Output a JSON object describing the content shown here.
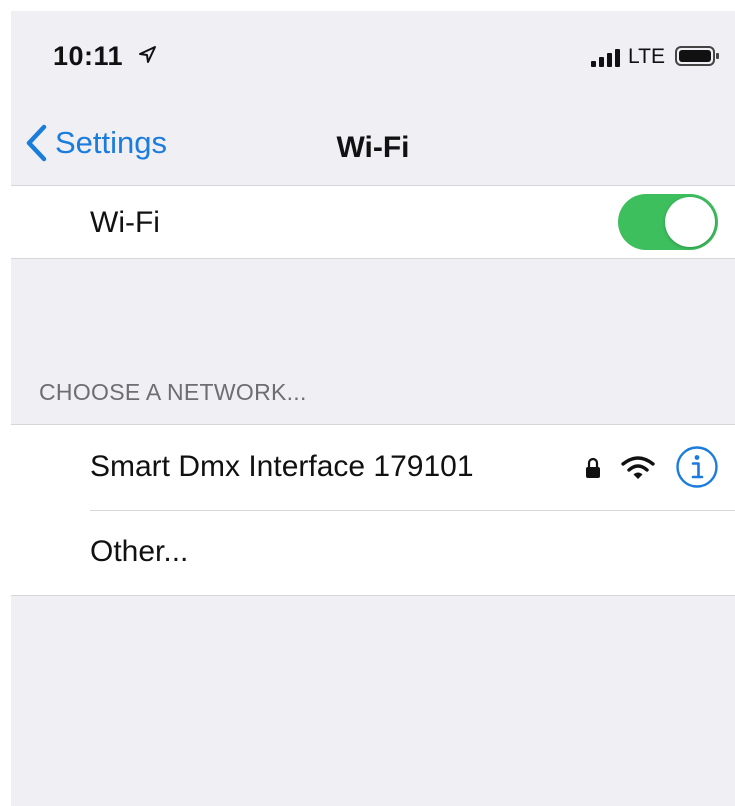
{
  "status_bar": {
    "time": "10:11",
    "network_type": "LTE",
    "icons": [
      "location-arrow-icon",
      "cellular-signal-icon",
      "battery-icon"
    ]
  },
  "nav": {
    "back_label": "Settings",
    "title": "Wi-Fi",
    "back_icon": "chevron-left-icon"
  },
  "wifi_toggle": {
    "label": "Wi-Fi",
    "on": true,
    "on_color": "#3dbf5e"
  },
  "section": {
    "header": "CHOOSE A NETWORK..."
  },
  "networks": [
    {
      "name": "Smart Dmx Interface 179101",
      "secured": true,
      "icons": [
        "lock-icon",
        "wifi-strength-icon",
        "info-icon"
      ]
    }
  ],
  "other_label": "Other...",
  "colors": {
    "accent": "#1a7cdc",
    "grouped_background": "#efeff4",
    "section_header_text": "#6d6d72"
  }
}
